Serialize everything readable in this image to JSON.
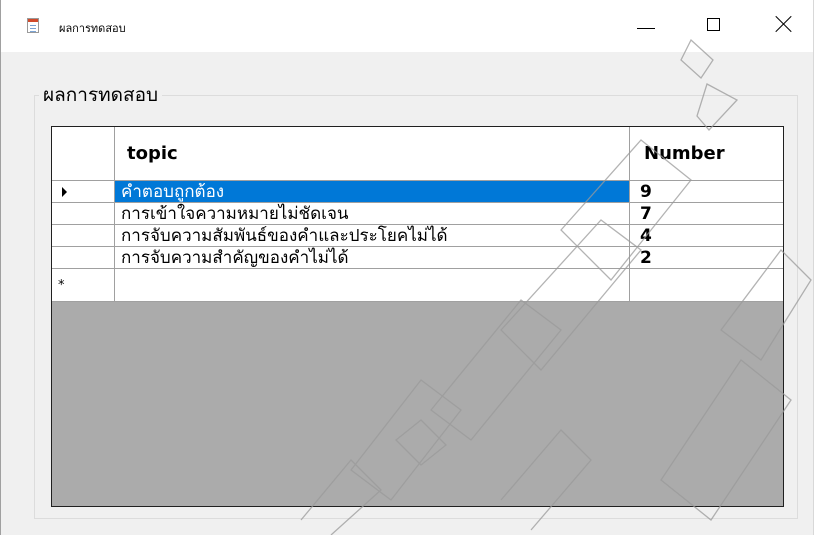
{
  "window": {
    "title": "ผลการทดสอบ",
    "icon": "form-icon"
  },
  "caption_buttons": {
    "minimize_icon": "minimize-icon",
    "maximize_icon": "maximize-icon",
    "close_icon": "close-icon"
  },
  "group": {
    "title": "ผลการทดสอบ"
  },
  "grid": {
    "columns": [
      "topic",
      "Number"
    ],
    "rows": [
      {
        "topic": "คำตอบถูกต้อง",
        "number": "9"
      },
      {
        "topic": "การเข้าใจความหมายไม่ชัดเจน",
        "number": "7"
      },
      {
        "topic": "การจับความสัมพันธ์ของคำและประโยคไม่ได้",
        "number": "4"
      },
      {
        "topic": "การจับความสำคัญของคำไม่ได้",
        "number": "2"
      }
    ],
    "selected_row": 0,
    "new_row_marker": "*",
    "selection_color": "#0078d7"
  }
}
